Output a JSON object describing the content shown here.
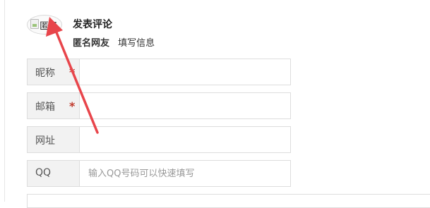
{
  "avatar": {
    "alt_text": "匿名",
    "icon": "broken-image-icon"
  },
  "header": {
    "title": "发表评论",
    "nickname": "匿名网友",
    "fill_info_link": "填写信息"
  },
  "form": {
    "fields": [
      {
        "label": "昵称",
        "required": true,
        "value": "",
        "placeholder": ""
      },
      {
        "label": "邮箱",
        "required": true,
        "value": "",
        "placeholder": ""
      },
      {
        "label": "网址",
        "required": false,
        "value": "",
        "placeholder": ""
      },
      {
        "label": "QQ",
        "required": false,
        "value": "",
        "placeholder": "输入QQ号码可以快速填写"
      }
    ],
    "required_mark": "*"
  },
  "annotation": {
    "icon": "red-arrow-icon",
    "color": "#e8454b"
  },
  "colors": {
    "label_bg": "#f2f2f2",
    "border": "#dddddd",
    "required": "#c0392b"
  }
}
